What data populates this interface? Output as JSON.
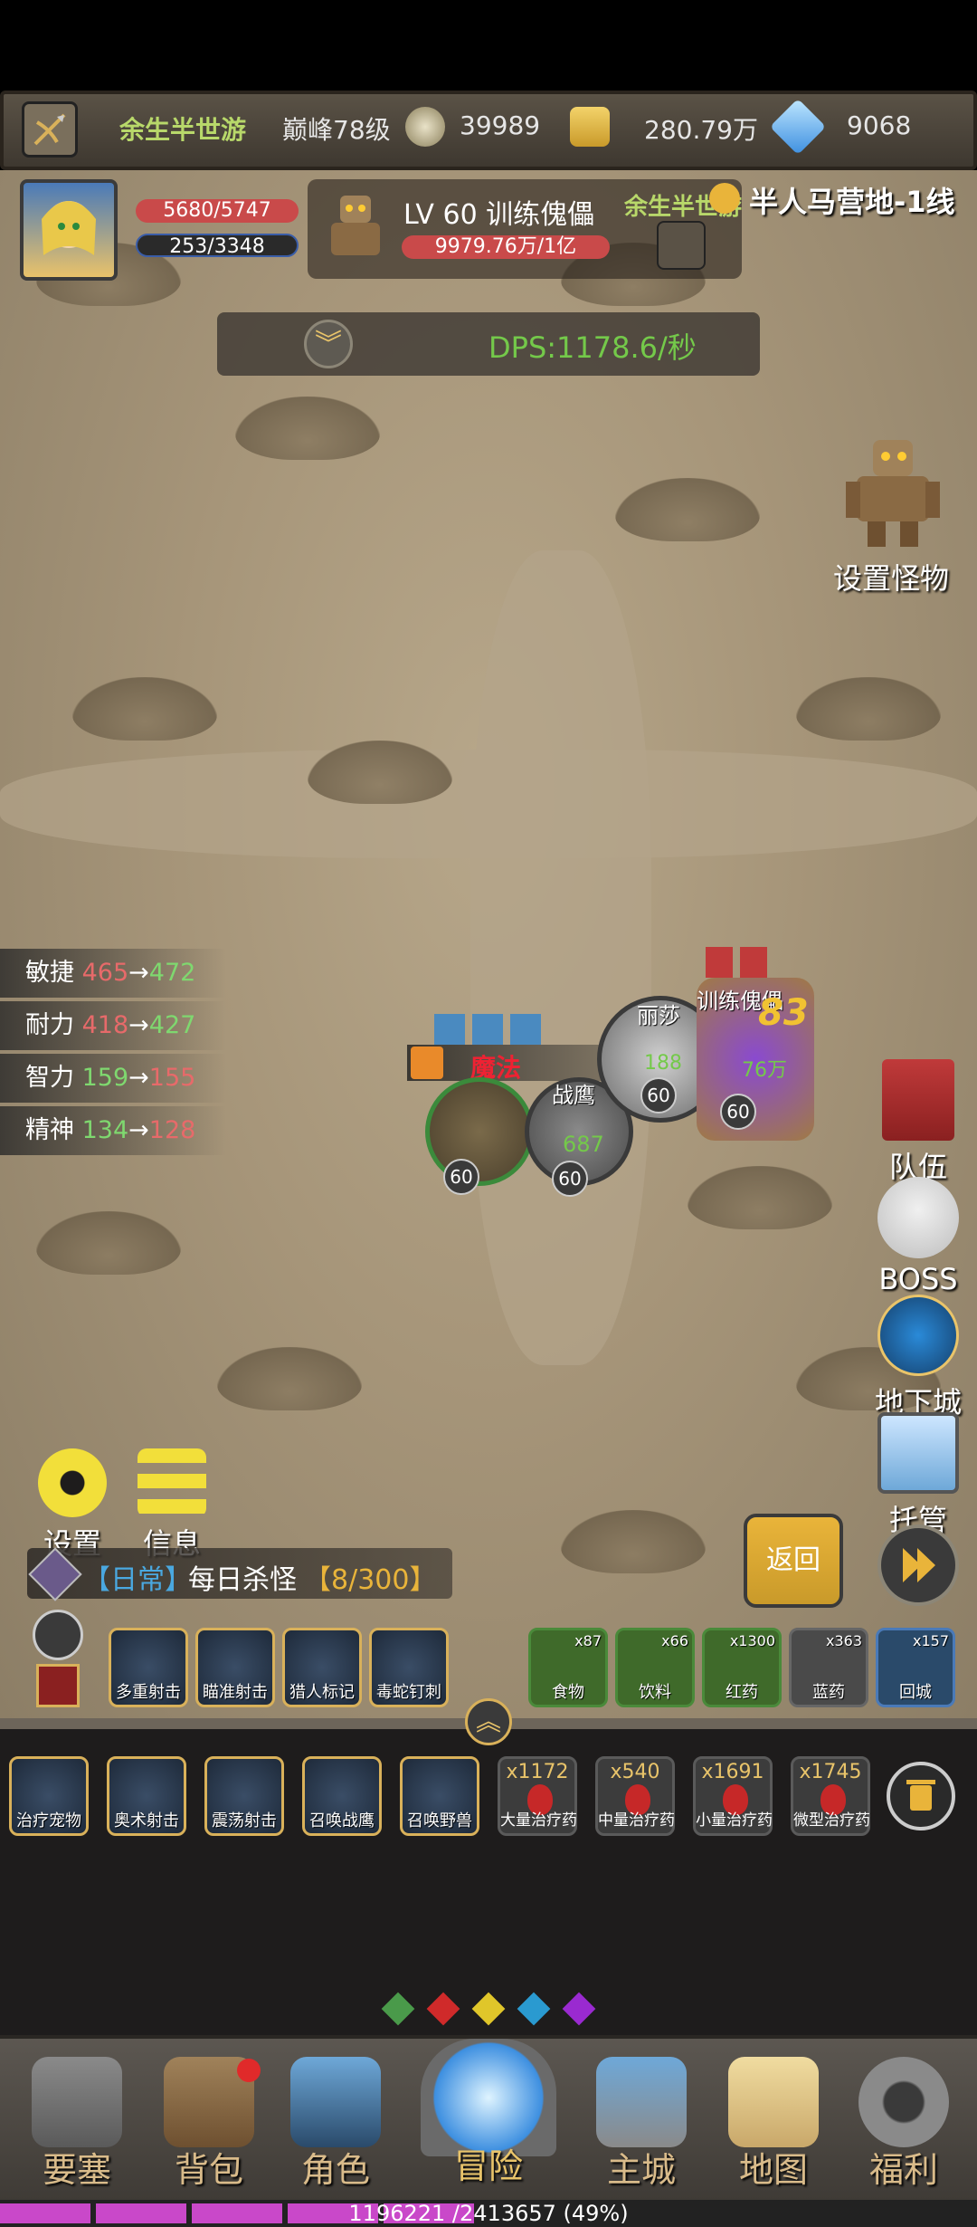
{
  "topbar": {
    "player_name": "余生半世游",
    "rank": "巅峰78级",
    "coins": "39989",
    "gold": "280.79万",
    "diamonds": "9068"
  },
  "player": {
    "hp": "5680/5747",
    "mp": "253/3348",
    "hp_fraction": 0.988,
    "mp_fraction": 0.076
  },
  "monster": {
    "name": "LV 60 训练傀儡",
    "hp": "9979.76万/1亿",
    "tag_name": "余生半世游"
  },
  "map_name": "半人马营地-1线",
  "dps": "DPS:1178.6/秒",
  "set_monster_label": "设置怪物",
  "stats": [
    {
      "name": "敏捷",
      "from": "465",
      "arrow": "→",
      "to": "472",
      "dir": "up"
    },
    {
      "name": "耐力",
      "from": "418",
      "arrow": "→",
      "to": "427",
      "dir": "up"
    },
    {
      "name": "智力",
      "from": "159",
      "arrow": "→",
      "to": "155",
      "dir": "down"
    },
    {
      "name": "精神",
      "from": "134",
      "arrow": "→",
      "to": "128",
      "dir": "down"
    }
  ],
  "battle": {
    "name_lisha": "丽莎",
    "name_puppet": "训练傀儡",
    "name_hawk": "战鹰",
    "damage_big": "83",
    "num_188": "188",
    "num_76": "76万",
    "num_687": "687",
    "lv": "60",
    "banner": "魔法"
  },
  "side_buttons": {
    "team": "队伍",
    "boss": "BOSS",
    "dungeon": "地下城",
    "auto": "托管"
  },
  "settings_label": "设置",
  "info_label": "信息",
  "quest": {
    "tag": "【日常】",
    "title": "每日杀怪",
    "progress": "【8/300】"
  },
  "return_label": "返回",
  "skills_row1": [
    "多重射击",
    "瞄准射击",
    "猎人标记",
    "毒蛇钉刺"
  ],
  "items_row1": [
    {
      "label": "食物",
      "count": "x87"
    },
    {
      "label": "饮料",
      "count": "x66"
    },
    {
      "label": "红药",
      "count": "x1300"
    },
    {
      "label": "蓝药",
      "count": "x363"
    },
    {
      "label": "回城",
      "count": "x157"
    }
  ],
  "skills_row2": [
    "治疗宠物",
    "奥术射击",
    "震荡射击",
    "召唤战鹰",
    "召唤野兽"
  ],
  "items_row2": [
    {
      "label": "大量治疗药",
      "count": "x1172"
    },
    {
      "label": "中量治疗药",
      "count": "x540"
    },
    {
      "label": "小量治疗药",
      "count": "x1691"
    },
    {
      "label": "微型治疗药",
      "count": "x1745"
    }
  ],
  "nav": [
    "要塞",
    "背包",
    "角色",
    "冒险",
    "主城",
    "地图",
    "福利"
  ],
  "exp": {
    "text": "1196221 /2413657 (49%)",
    "fraction": 0.49
  },
  "colors": {
    "name_green": "#b8d86a",
    "hp_red": "#c94a4a",
    "mp_blue": "#3a5da8",
    "dps_green": "#74c94a",
    "exp_purple": "#c948c9"
  }
}
